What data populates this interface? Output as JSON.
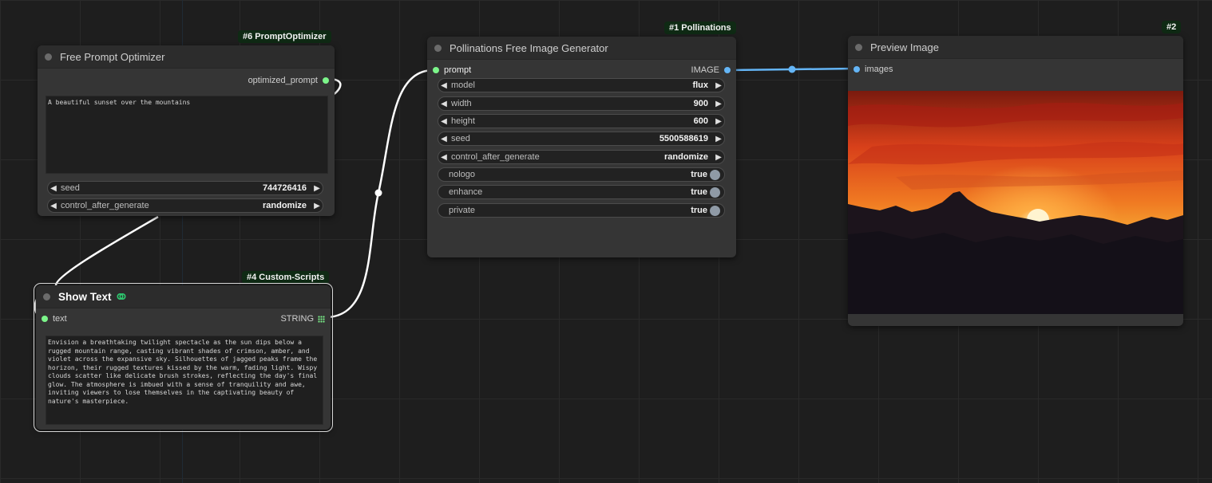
{
  "nodes": {
    "prompt_optimizer": {
      "badge": "#6 PromptOptimizer",
      "title": "Free Prompt Optimizer",
      "output_label": "optimized_prompt",
      "text": "A beautiful sunset over the mountains",
      "widgets": [
        {
          "label": "seed",
          "value": "744726416"
        },
        {
          "label": "control_after_generate",
          "value": "randomize"
        }
      ]
    },
    "show_text": {
      "badge": "#4 Custom-Scripts",
      "title": "Show Text",
      "input_label": "text",
      "output_label": "STRING",
      "text": "Envision a breathtaking twilight spectacle as the sun dips below a rugged mountain range, casting vibrant shades of crimson, amber, and violet across the expansive sky. Silhouettes of jagged peaks frame the horizon, their rugged textures kissed by the warm, fading light. Wispy clouds scatter like delicate brush strokes, reflecting the day's final glow. The atmosphere is imbued with a sense of tranquility and awe, inviting viewers to lose themselves in the captivating beauty of nature's masterpiece."
    },
    "pollinations": {
      "badge": "#1 Pollinations",
      "title": "Pollinations Free Image Generator",
      "input_label": "prompt",
      "output_label": "IMAGE",
      "widgets": [
        {
          "label": "model",
          "value": "flux"
        },
        {
          "label": "width",
          "value": "900"
        },
        {
          "label": "height",
          "value": "600"
        },
        {
          "label": "seed",
          "value": "5500588619"
        },
        {
          "label": "control_after_generate",
          "value": "randomize"
        }
      ],
      "toggles": [
        {
          "label": "nologo",
          "value": "true"
        },
        {
          "label": "enhance",
          "value": "true"
        },
        {
          "label": "private",
          "value": "true"
        }
      ]
    },
    "preview": {
      "badge": "#2",
      "title": "Preview Image",
      "input_label": "images"
    }
  },
  "colors": {
    "canvas_bg": "#1e1e1e",
    "node_bg": "#353535",
    "link_image": "#64b5f6",
    "link_string": "#ffffff",
    "socket_string": "#7cf58a"
  }
}
